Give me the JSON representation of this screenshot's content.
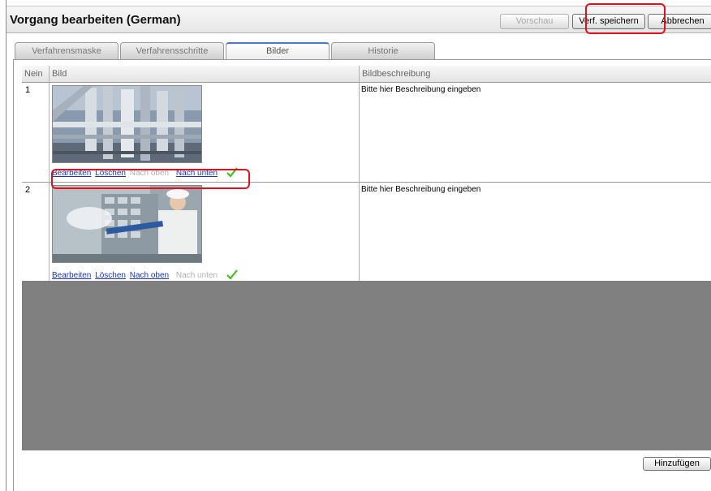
{
  "header": {
    "title": "Vorgang bearbeiten (German)",
    "preview_label": "Vorschau",
    "save_label": "Verf. speichern",
    "cancel_label": "Abbrechen"
  },
  "tabs": [
    {
      "label": "Verfahrensmaske"
    },
    {
      "label": "Verfahrensschritte"
    },
    {
      "label": "Bilder"
    },
    {
      "label": "Historie"
    }
  ],
  "table": {
    "columns": [
      "Nein",
      "Bild",
      "Bildbeschreibung"
    ],
    "rows": [
      {
        "no": "1",
        "description": "Bitte hier Beschreibung eingeben",
        "actions": {
          "edit": "Bearbeiten",
          "delete": "Löschen",
          "up": "Nach oben",
          "down": "Nach unten"
        }
      },
      {
        "no": "2",
        "description": "Bitte hier Beschreibung eingeben",
        "actions": {
          "edit": "Bearbeiten",
          "delete": "Löschen",
          "up": "Nach oben",
          "down": "Nach unten"
        }
      }
    ]
  },
  "footer": {
    "add_label": "Hinzufügen"
  },
  "colors": {
    "annotation": "#e3101a",
    "link": "#1a33c8",
    "active_tab": "#4a78c8",
    "grid_bg": "#808080",
    "check": "#3dc21b"
  }
}
